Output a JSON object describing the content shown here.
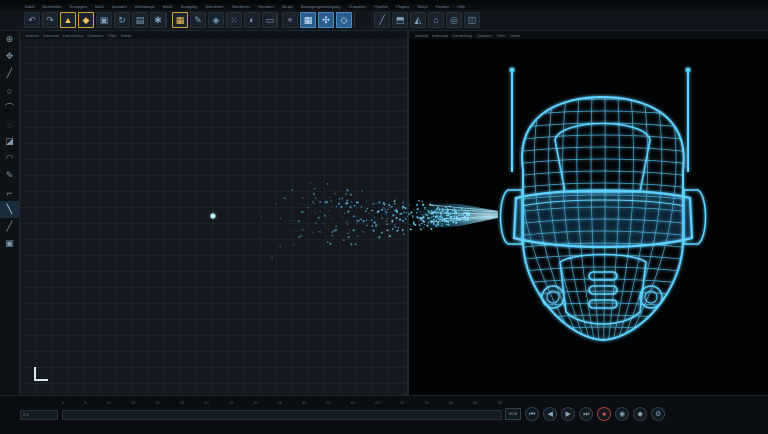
{
  "menu": {
    "items": [
      "Datei",
      "Bearbeiten",
      "Erzeugen",
      "Modi",
      "Auswahl",
      "Werkzeuge",
      "Mesh",
      "Snapping",
      "Animieren",
      "Simulieren",
      "Rendern",
      "Skulpt",
      "Bewegungsverfolgung",
      "Charakter",
      "Pipeline",
      "Plugins",
      "Skript",
      "Fenster",
      "Hilfe"
    ]
  },
  "toolbar": {
    "icons": [
      "undo-icon",
      "redo-icon",
      "live-selection-icon",
      "move-icon",
      "scale-icon",
      "rotate-icon",
      "render-view-icon",
      "render-settings-icon",
      "cube-icon",
      "pen-icon",
      "subdivision-icon",
      "array-icon",
      "deformer-icon",
      "floor-icon",
      "camera-icon",
      "light-icon",
      "snap-icon",
      "workplane-icon",
      "axis-icon",
      "model-mode-icon",
      "points-mode-icon",
      "edges-mode-icon",
      "polygons-mode-icon",
      "paint-icon",
      "knife-icon",
      "extrude-icon",
      "bevel-icon",
      "bridge-icon",
      "weld-icon",
      "magnet-icon"
    ]
  },
  "tools": [
    "pointer-tool-icon",
    "lasso-tool-icon",
    "knife-tool-icon",
    "brush-tool-icon",
    "ring-tool-icon",
    "loop-tool-icon",
    "fill-tool-icon",
    "smooth-tool-icon",
    "flatten-tool-icon",
    "grab-tool-icon",
    "slide-tool-icon",
    "stitch-tool-icon",
    "pin-tool-icon"
  ],
  "viewport_left": {
    "menu": [
      "Ansicht",
      "Kameras",
      "Darstellung",
      "Optionen",
      "Filter",
      "Tafeln"
    ]
  },
  "viewport_right": {
    "menu": [
      "Ansicht",
      "Kameras",
      "Darstellung",
      "Optionen",
      "Filter",
      "Tafeln"
    ]
  },
  "timeline": {
    "frames": [
      "0",
      "5",
      "10",
      "15",
      "20",
      "25",
      "30",
      "35",
      "40",
      "45",
      "50",
      "55",
      "60",
      "65",
      "70",
      "75",
      "80",
      "85",
      "90"
    ],
    "range_start": "0 B",
    "fps_label": "90 B"
  },
  "colors": {
    "accent": "#4a8cc4",
    "wireframe": "#5fd2ff",
    "record": "#e35a5a",
    "highlight": "#f4c35a"
  }
}
